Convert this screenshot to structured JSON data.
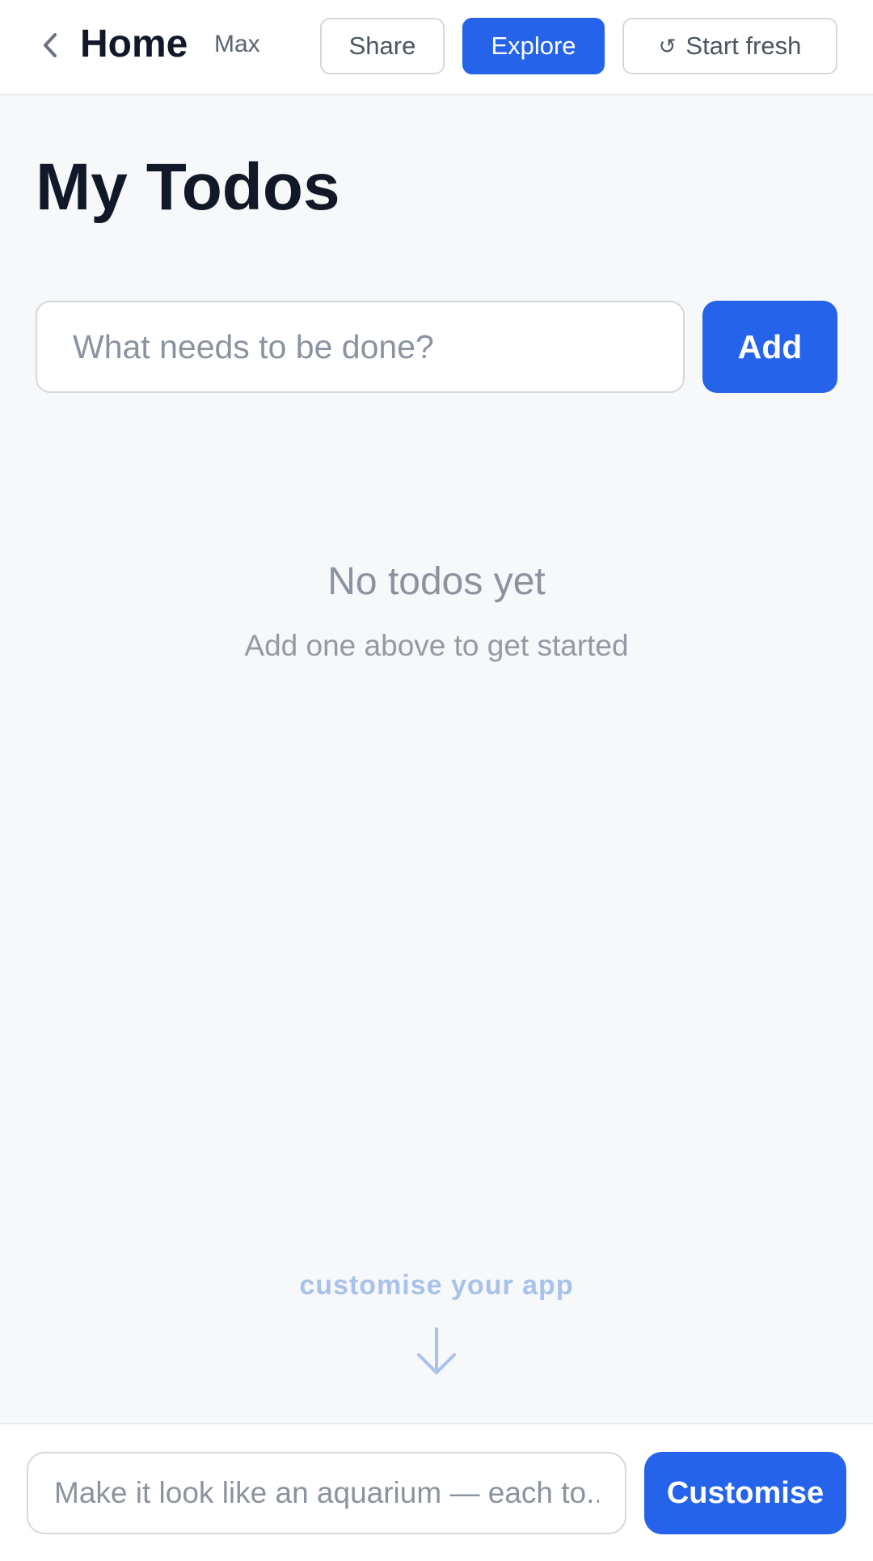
{
  "header": {
    "title": "Home",
    "user": "Max",
    "share_label": "Share",
    "explore_label": "Explore",
    "start_fresh_label": "Start fresh",
    "start_fresh_icon": "refresh-icon",
    "back_icon": "chevron-left-icon"
  },
  "main": {
    "title": "My Todos",
    "todo_input": {
      "placeholder": "What needs to be done?",
      "value": ""
    },
    "add_label": "Add",
    "empty_state": {
      "title": "No todos yet",
      "subtitle": "Add one above to get started"
    },
    "customise_hint": "customise your app",
    "hint_icon": "arrow-down-icon"
  },
  "footer": {
    "customise_input": {
      "placeholder": "Make it look like an aquarium — each to...",
      "value": ""
    },
    "customise_label": "Customise"
  },
  "colors": {
    "accent": "#2563eb",
    "background": "#f6f8fa",
    "hint": "#a8c2ec"
  }
}
